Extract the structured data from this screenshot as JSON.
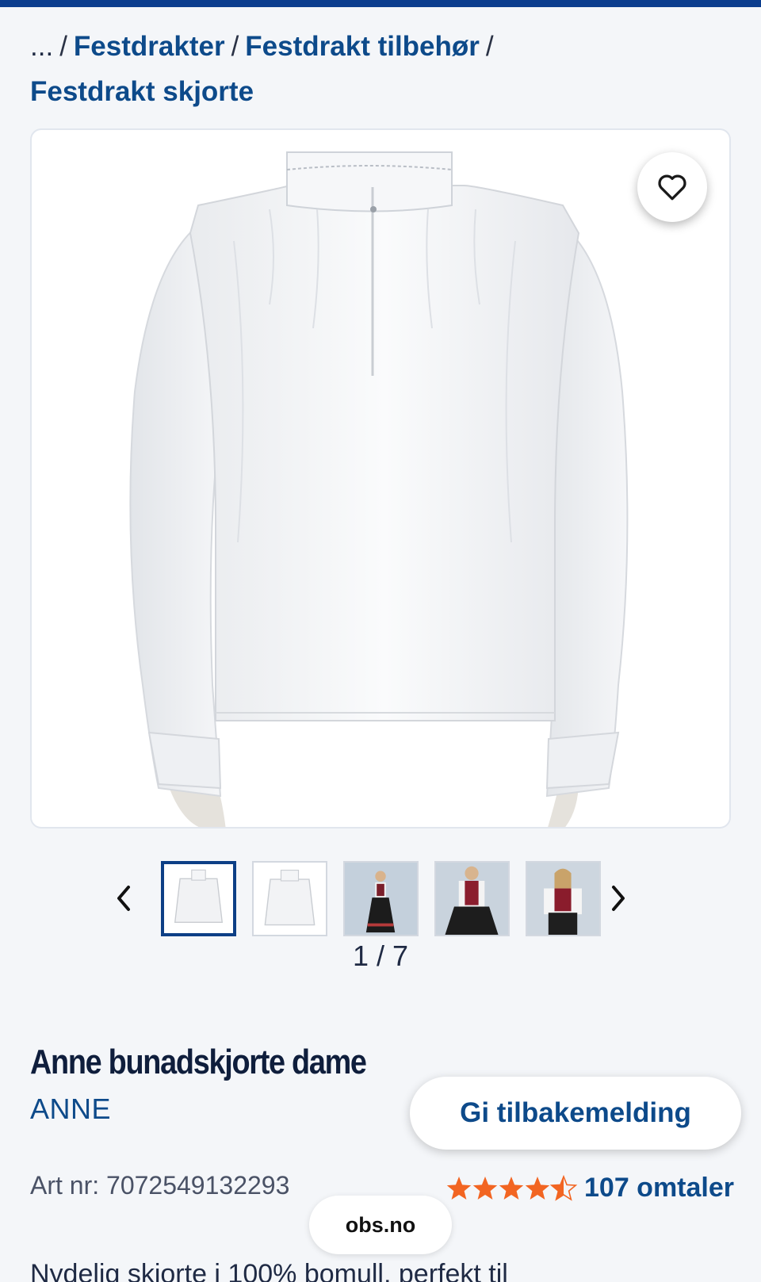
{
  "breadcrumb": {
    "ellipsis": "...",
    "separator": "/",
    "items": [
      "Festdrakter",
      "Festdrakt tilbehør",
      "Festdrakt skjorte"
    ]
  },
  "gallery": {
    "counter": "1 / 7",
    "thumbnail_count_visible": 5,
    "active_index": 0
  },
  "product": {
    "title": "Anne bunadskjorte dame",
    "brand": "ANNE",
    "art_nr": "Art nr: 7072549132293",
    "rating_value": 4.5,
    "reviews": "107 omtaler",
    "description": "Nydelig skjorte i 100% bomull, perfekt til"
  },
  "feedback_button": "Gi tilbakemelding",
  "domain_pill": "obs.no",
  "colors": {
    "accent_blue": "#0d4a8a",
    "top_bar": "#0b3d8e",
    "star_orange": "#f26522"
  }
}
